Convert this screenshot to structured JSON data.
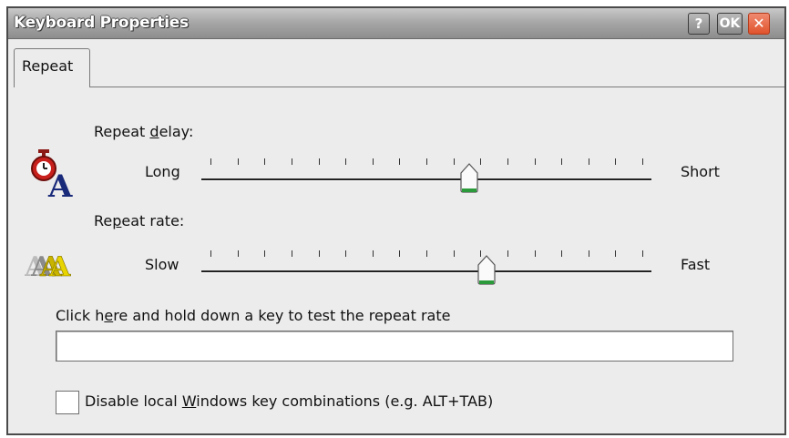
{
  "window": {
    "title": "Keyboard Properties",
    "buttons": {
      "help": "?",
      "ok": "OK",
      "close": "✕"
    }
  },
  "tabs": [
    {
      "label": "Repeat",
      "active": true
    }
  ],
  "repeat_delay": {
    "label_pre": "Repeat ",
    "label_ul": "d",
    "label_post": "elay:",
    "left_label": "Long",
    "right_label": "Short",
    "value_fraction": 0.6,
    "ticks": 17
  },
  "repeat_rate": {
    "label_pre": "Re",
    "label_ul": "p",
    "label_post": "eat rate:",
    "left_label": "Slow",
    "right_label": "Fast",
    "value_fraction": 0.64,
    "ticks": 17
  },
  "test_field": {
    "label_pre": "Click h",
    "label_ul": "e",
    "label_post": "re and hold down a key to test the repeat rate",
    "value": ""
  },
  "disable_keys": {
    "label_pre": "Disable local ",
    "label_ul": "W",
    "label_post": "indows key combinations (e.g. ALT+TAB)",
    "checked": false
  },
  "icons": {
    "delay": "stopwatch-letter-a-icon",
    "rate": "repeated-letter-a-icon"
  },
  "colors": {
    "titlebar": "#a8a8a8",
    "close_button": "#e0532c",
    "thumb_accent": "#2a9a3a",
    "icon_red": "#c8201c",
    "icon_navy": "#1a2a7a",
    "icon_gold": "#c9b400"
  }
}
